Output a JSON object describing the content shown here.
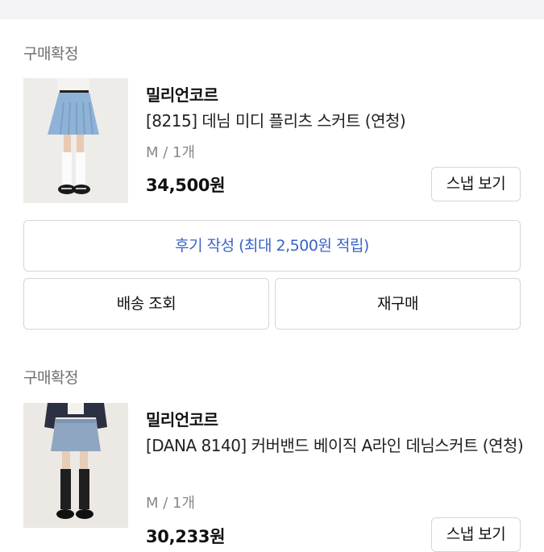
{
  "orders": [
    {
      "status": "구매확정",
      "brand": "밀리언코르",
      "product_name": "[8215] 데님 미디 플리츠 스커트 (연청)",
      "option": "M / 1개",
      "price": "34,500원",
      "snap_button": "스냅 보기",
      "review_button": "후기 작성 (최대 2,500원 적립)",
      "tracking_button": "배송 조회",
      "rebuy_button": "재구매"
    },
    {
      "status": "구매확정",
      "brand": "밀리언코르",
      "product_name": "[DANA 8140] 커버밴드 베이직 A라인 데님스커트 (연청)",
      "option": "M / 1개",
      "price": "30,233원",
      "snap_button": "스냅 보기"
    }
  ],
  "colors": {
    "accent_link": "#3a63c8",
    "muted_text": "#6f6f74",
    "border": "#d6d6d9"
  }
}
